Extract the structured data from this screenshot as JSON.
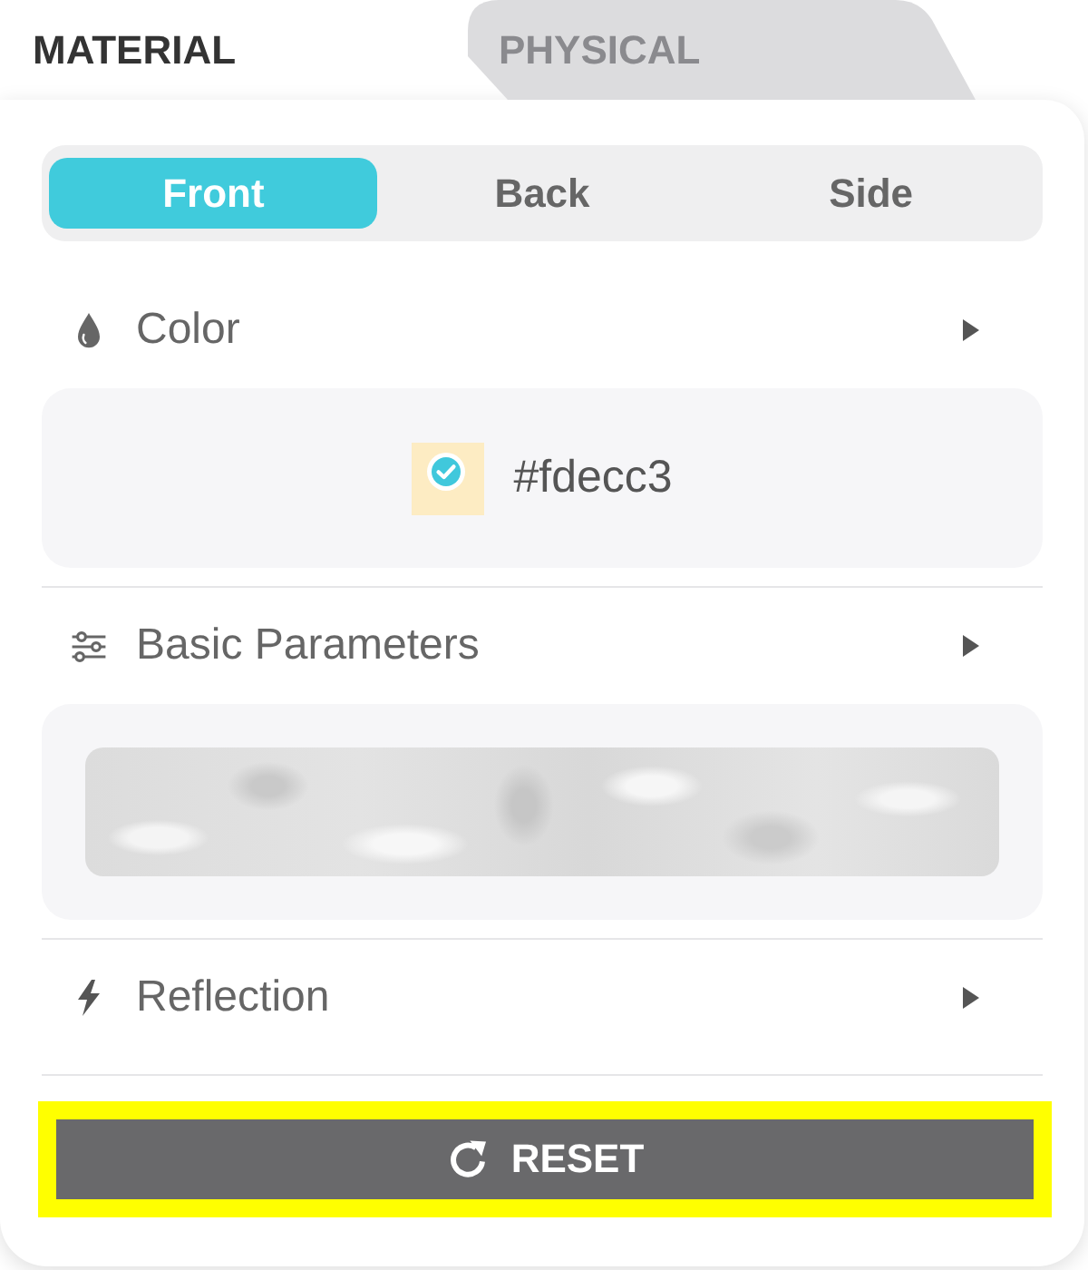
{
  "tabs": [
    {
      "label": "MATERIAL",
      "selected": true
    },
    {
      "label": "PHYSICAL",
      "selected": false
    }
  ],
  "sides": [
    {
      "label": "Front",
      "selected": true
    },
    {
      "label": "Back",
      "selected": false
    },
    {
      "label": "Side",
      "selected": false
    }
  ],
  "sections": [
    {
      "kind": "swatch",
      "title": "Color",
      "swatch": {
        "color": "#fdecc3",
        "checked": true
      },
      "value": "#fdecc3"
    },
    {
      "kind": "texture",
      "title": "Basic Parameters"
    },
    {
      "kind": "plain",
      "title": "Reflection"
    }
  ],
  "reset_button": {
    "label": "RESET",
    "highlighted": true
  }
}
